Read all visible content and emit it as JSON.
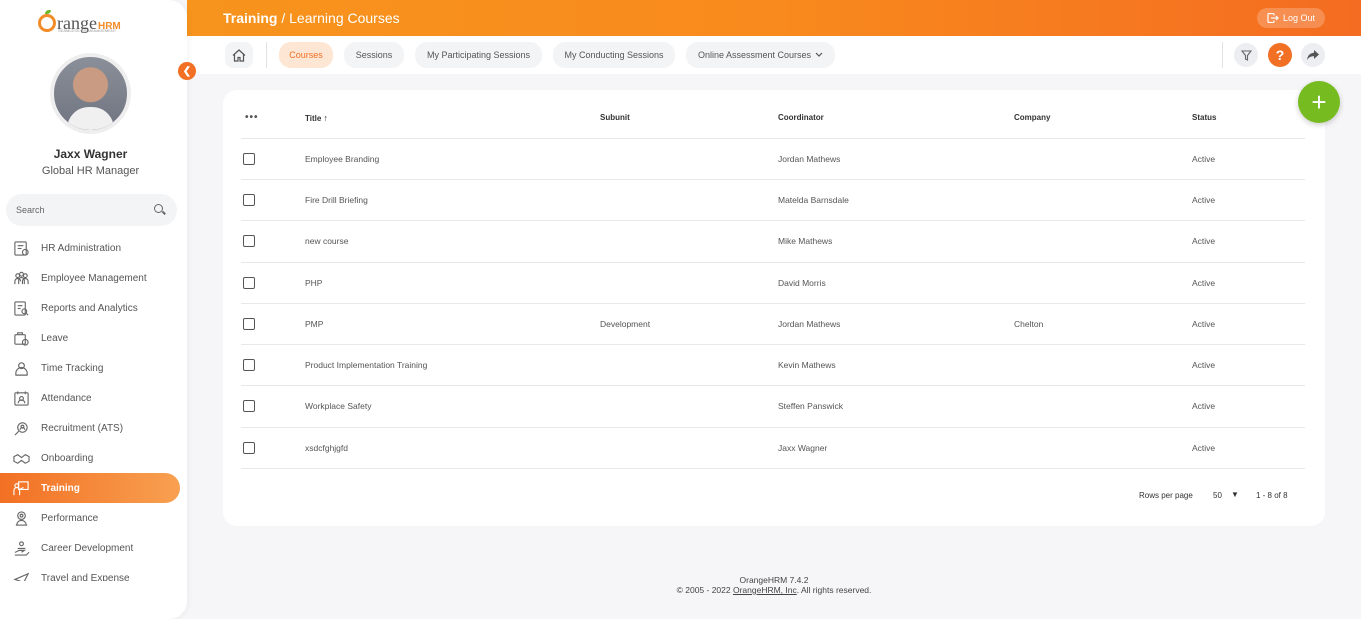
{
  "brand": {
    "logo_text": "range",
    "logo_hrm": "HRM",
    "tagline": "SEAMLESS HR MANAGEMENT"
  },
  "user": {
    "name": "Jaxx Wagner",
    "role": "Global HR Manager"
  },
  "search": {
    "placeholder": "Search"
  },
  "menu": [
    {
      "label": "HR Administration",
      "icon": "hr-admin-icon"
    },
    {
      "label": "Employee Management",
      "icon": "employees-icon"
    },
    {
      "label": "Reports and Analytics",
      "icon": "reports-icon"
    },
    {
      "label": "Leave",
      "icon": "leave-icon"
    },
    {
      "label": "Time Tracking",
      "icon": "time-icon"
    },
    {
      "label": "Attendance",
      "icon": "attendance-icon"
    },
    {
      "label": "Recruitment (ATS)",
      "icon": "recruitment-icon"
    },
    {
      "label": "Onboarding",
      "icon": "onboarding-icon"
    },
    {
      "label": "Training",
      "icon": "training-icon",
      "active": true
    },
    {
      "label": "Performance",
      "icon": "performance-icon"
    },
    {
      "label": "Career Development",
      "icon": "career-icon"
    },
    {
      "label": "Travel and Expense",
      "icon": "travel-icon"
    }
  ],
  "header": {
    "section": "Training",
    "separator": " / ",
    "page": "Learning Courses",
    "logout": "Log Out"
  },
  "tabs": {
    "courses": "Courses",
    "sessions": "Sessions",
    "participating": "My Participating Sessions",
    "conducting": "My Conducting Sessions",
    "online": "Online Assessment Courses"
  },
  "table": {
    "columns": {
      "title": "Title",
      "subunit": "Subunit",
      "coordinator": "Coordinator",
      "company": "Company",
      "status": "Status"
    },
    "rows": [
      {
        "title": "Employee Branding",
        "subunit": "",
        "coordinator": "Jordan Mathews",
        "company": "",
        "status": "Active"
      },
      {
        "title": "Fire Drill Briefing",
        "subunit": "",
        "coordinator": "Matelda Barnsdale",
        "company": "",
        "status": "Active"
      },
      {
        "title": "new course",
        "subunit": "",
        "coordinator": "Mike Mathews",
        "company": "",
        "status": "Active"
      },
      {
        "title": "PHP",
        "subunit": "",
        "coordinator": "David Morris",
        "company": "",
        "status": "Active"
      },
      {
        "title": "PMP",
        "subunit": "Development",
        "coordinator": "Jordan Mathews",
        "company": "Chelton",
        "status": "Active"
      },
      {
        "title": "Product Implementation Training",
        "subunit": "",
        "coordinator": "Kevin Mathews",
        "company": "",
        "status": "Active"
      },
      {
        "title": "Workplace Safety",
        "subunit": "",
        "coordinator": "Steffen Panswick",
        "company": "",
        "status": "Active"
      },
      {
        "title": "xsdcfghjgfd",
        "subunit": "",
        "coordinator": "Jaxx Wagner",
        "company": "",
        "status": "Active"
      }
    ]
  },
  "pagination": {
    "rows_per_page_label": "Rows per page",
    "rows_per_page": "50",
    "range": "1 - 8 of 8"
  },
  "footer": {
    "version": "OrangeHRM 7.4.2",
    "copyright_prefix": "© 2005 - 2022 ",
    "company_link": "OrangeHRM, Inc",
    "copyright_suffix": ". All rights reserved."
  },
  "colors": {
    "accent": "#f27024",
    "fab": "#76bc21"
  }
}
